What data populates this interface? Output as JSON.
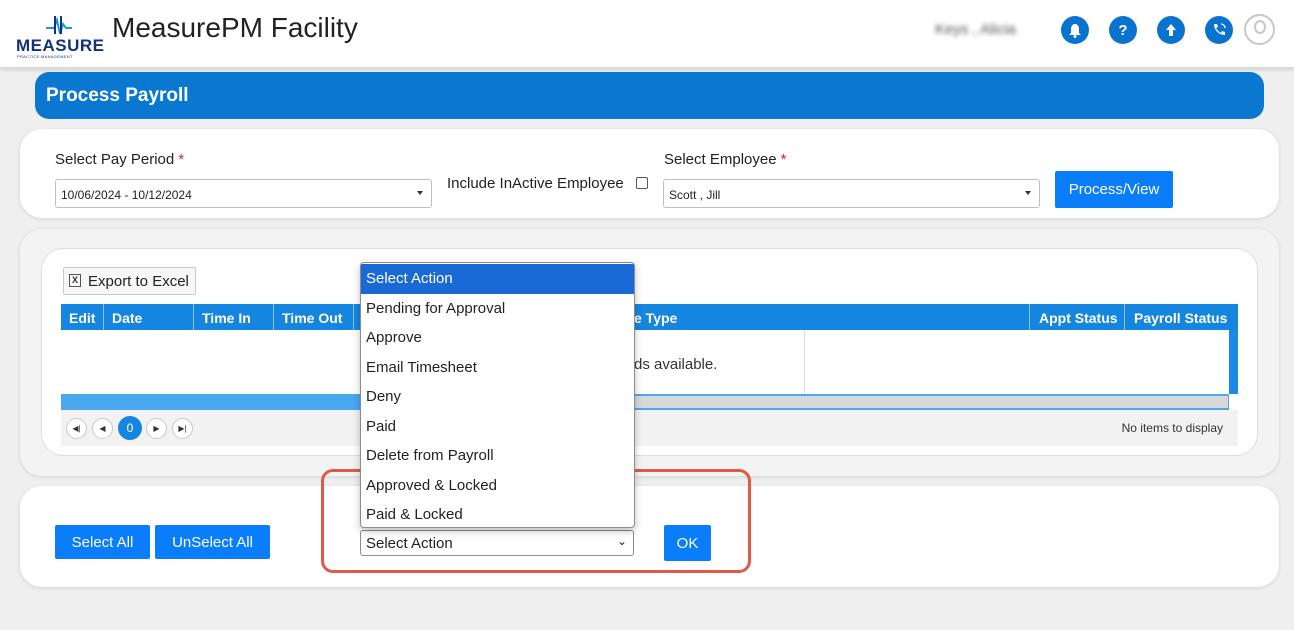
{
  "header": {
    "logo_text": "MEASURE",
    "logo_sub": "PRACTICE MANAGEMENT",
    "app_title": "MeasurePM Facility",
    "user_name": "Keys , Alicia",
    "icons": [
      "bell-icon",
      "help-icon",
      "upload-icon",
      "phone-icon",
      "user-avatar-icon"
    ]
  },
  "page": {
    "title": "Process Payroll"
  },
  "filters": {
    "pay_period_label": "Select Pay Period",
    "required_mark": "*",
    "pay_period_value": "10/06/2024 - 10/12/2024",
    "include_inactive_label": "Include InActive Employee",
    "include_inactive_checked": false,
    "employee_label": "Select Employee",
    "employee_value": "Scott , Jill",
    "process_button": "Process/View"
  },
  "grid": {
    "export_label": "Export to Excel",
    "columns": [
      "Edit",
      "Date",
      "Time In",
      "Time Out",
      "e Type",
      "Appt Status",
      "Payroll Status"
    ],
    "no_records": "ds available.",
    "current_page": "0",
    "no_items": "No items to display"
  },
  "actions": {
    "select_all": "Select All",
    "unselect_all": "UnSelect All",
    "select_value": "Select Action",
    "ok": "OK",
    "options": [
      "Select Action",
      "Pending for Approval",
      "Approve",
      "Email Timesheet",
      "Deny",
      "Paid",
      "Delete from Payroll",
      "Approved & Locked",
      "Paid & Locked"
    ],
    "selected_index": 0
  },
  "colors": {
    "brand_blue": "#0a78d0",
    "button_blue": "#0a7dfa",
    "highlight_red": "#e15a48"
  }
}
